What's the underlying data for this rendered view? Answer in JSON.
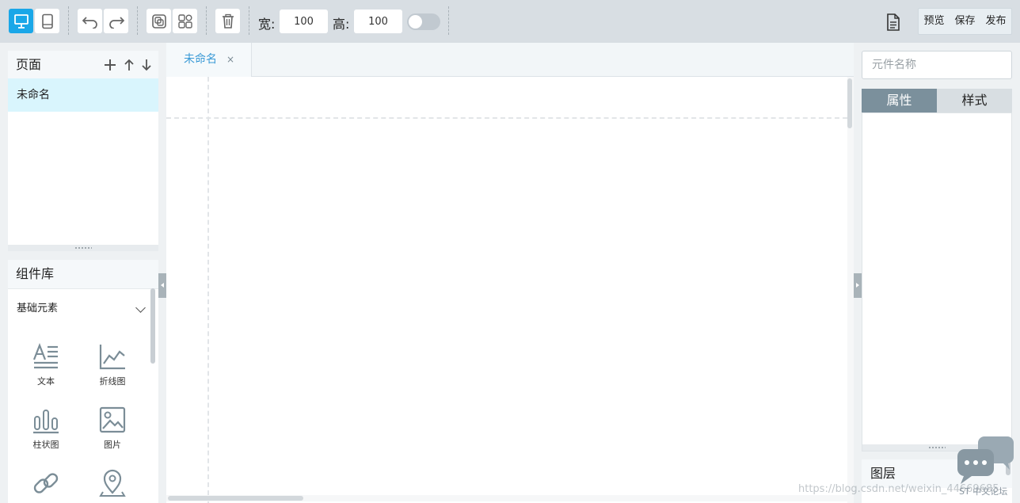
{
  "toolbar": {
    "buttons": [
      {
        "name": "desktop-view",
        "icon": "monitor-icon",
        "active": true
      },
      {
        "name": "mobile-view",
        "icon": "tablet-icon",
        "active": false
      },
      {
        "name": "undo",
        "icon": "undo-icon"
      },
      {
        "name": "redo",
        "icon": "redo-icon"
      },
      {
        "name": "group",
        "icon": "group-icon"
      },
      {
        "name": "ungroup",
        "icon": "ungroup-icon"
      },
      {
        "name": "delete",
        "icon": "trash-icon"
      }
    ],
    "width_label": "宽:",
    "width_value": "100",
    "height_label": "高:",
    "height_value": "100",
    "toggle_on": false,
    "actions": {
      "preview": "预览",
      "save": "保存",
      "publish": "发布"
    },
    "accent_color": "#1aa7e8"
  },
  "pages_panel": {
    "title": "页面",
    "pages": [
      {
        "label": "未命名",
        "selected": true
      }
    ]
  },
  "components_panel": {
    "title": "组件库",
    "category": "基础元素",
    "items": [
      {
        "label": "文本",
        "icon": "text-icon"
      },
      {
        "label": "折线图",
        "icon": "line-chart-icon"
      },
      {
        "label": "柱状图",
        "icon": "bar-chart-icon"
      },
      {
        "label": "图片",
        "icon": "image-icon"
      },
      {
        "label": "",
        "icon": "link-icon"
      },
      {
        "label": "",
        "icon": "map-pin-icon"
      }
    ]
  },
  "canvas": {
    "tabs": [
      {
        "label": "未命名",
        "close": "×"
      }
    ]
  },
  "right_panel": {
    "name_placeholder": "元件名称",
    "tabs": [
      {
        "label": "属性",
        "active": true
      },
      {
        "label": "样式",
        "active": false
      }
    ],
    "layers_title": "图层"
  },
  "overlay": {
    "watermark": "https://blog.csdn.net/weixin_44669685",
    "forum_label": "ST 中文论坛"
  }
}
